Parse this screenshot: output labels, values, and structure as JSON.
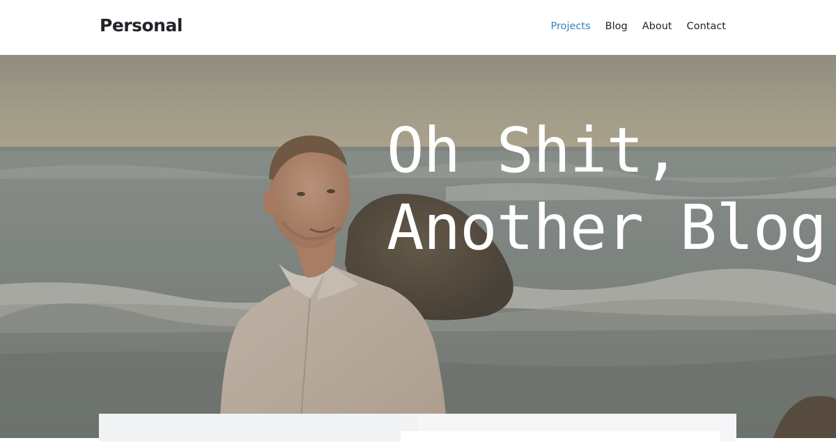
{
  "brand": {
    "name": "Personal"
  },
  "nav": {
    "items": [
      {
        "label": "Projects",
        "active": true
      },
      {
        "label": "Blog",
        "active": false
      },
      {
        "label": "About",
        "active": false
      },
      {
        "label": "Contact",
        "active": false
      }
    ]
  },
  "hero": {
    "title_line1": "Oh Shit,",
    "title_line2": "Another Blog"
  },
  "colors": {
    "accent": "#2f83c4",
    "text": "#212529",
    "hero_text": "#ffffff"
  }
}
